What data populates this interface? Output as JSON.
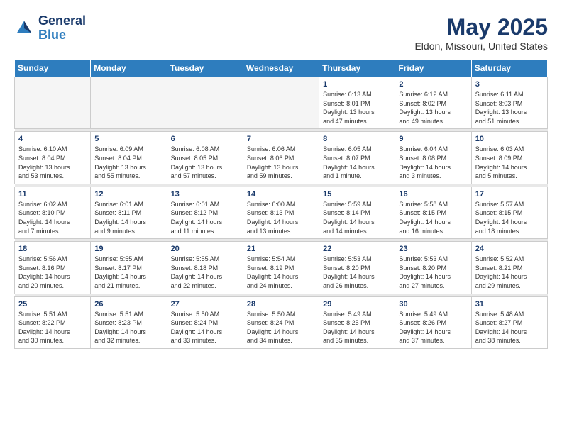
{
  "header": {
    "logo_general": "General",
    "logo_blue": "Blue",
    "title": "May 2025",
    "location": "Eldon, Missouri, United States"
  },
  "weekdays": [
    "Sunday",
    "Monday",
    "Tuesday",
    "Wednesday",
    "Thursday",
    "Friday",
    "Saturday"
  ],
  "weeks": [
    [
      {
        "day": "",
        "empty": true
      },
      {
        "day": "",
        "empty": true
      },
      {
        "day": "",
        "empty": true
      },
      {
        "day": "",
        "empty": true
      },
      {
        "day": "1",
        "info": "Sunrise: 6:13 AM\nSunset: 8:01 PM\nDaylight: 13 hours\nand 47 minutes."
      },
      {
        "day": "2",
        "info": "Sunrise: 6:12 AM\nSunset: 8:02 PM\nDaylight: 13 hours\nand 49 minutes."
      },
      {
        "day": "3",
        "info": "Sunrise: 6:11 AM\nSunset: 8:03 PM\nDaylight: 13 hours\nand 51 minutes."
      }
    ],
    [
      {
        "day": "4",
        "info": "Sunrise: 6:10 AM\nSunset: 8:04 PM\nDaylight: 13 hours\nand 53 minutes."
      },
      {
        "day": "5",
        "info": "Sunrise: 6:09 AM\nSunset: 8:04 PM\nDaylight: 13 hours\nand 55 minutes."
      },
      {
        "day": "6",
        "info": "Sunrise: 6:08 AM\nSunset: 8:05 PM\nDaylight: 13 hours\nand 57 minutes."
      },
      {
        "day": "7",
        "info": "Sunrise: 6:06 AM\nSunset: 8:06 PM\nDaylight: 13 hours\nand 59 minutes."
      },
      {
        "day": "8",
        "info": "Sunrise: 6:05 AM\nSunset: 8:07 PM\nDaylight: 14 hours\nand 1 minute."
      },
      {
        "day": "9",
        "info": "Sunrise: 6:04 AM\nSunset: 8:08 PM\nDaylight: 14 hours\nand 3 minutes."
      },
      {
        "day": "10",
        "info": "Sunrise: 6:03 AM\nSunset: 8:09 PM\nDaylight: 14 hours\nand 5 minutes."
      }
    ],
    [
      {
        "day": "11",
        "info": "Sunrise: 6:02 AM\nSunset: 8:10 PM\nDaylight: 14 hours\nand 7 minutes."
      },
      {
        "day": "12",
        "info": "Sunrise: 6:01 AM\nSunset: 8:11 PM\nDaylight: 14 hours\nand 9 minutes."
      },
      {
        "day": "13",
        "info": "Sunrise: 6:01 AM\nSunset: 8:12 PM\nDaylight: 14 hours\nand 11 minutes."
      },
      {
        "day": "14",
        "info": "Sunrise: 6:00 AM\nSunset: 8:13 PM\nDaylight: 14 hours\nand 13 minutes."
      },
      {
        "day": "15",
        "info": "Sunrise: 5:59 AM\nSunset: 8:14 PM\nDaylight: 14 hours\nand 14 minutes."
      },
      {
        "day": "16",
        "info": "Sunrise: 5:58 AM\nSunset: 8:15 PM\nDaylight: 14 hours\nand 16 minutes."
      },
      {
        "day": "17",
        "info": "Sunrise: 5:57 AM\nSunset: 8:15 PM\nDaylight: 14 hours\nand 18 minutes."
      }
    ],
    [
      {
        "day": "18",
        "info": "Sunrise: 5:56 AM\nSunset: 8:16 PM\nDaylight: 14 hours\nand 20 minutes."
      },
      {
        "day": "19",
        "info": "Sunrise: 5:55 AM\nSunset: 8:17 PM\nDaylight: 14 hours\nand 21 minutes."
      },
      {
        "day": "20",
        "info": "Sunrise: 5:55 AM\nSunset: 8:18 PM\nDaylight: 14 hours\nand 22 minutes."
      },
      {
        "day": "21",
        "info": "Sunrise: 5:54 AM\nSunset: 8:19 PM\nDaylight: 14 hours\nand 24 minutes."
      },
      {
        "day": "22",
        "info": "Sunrise: 5:53 AM\nSunset: 8:20 PM\nDaylight: 14 hours\nand 26 minutes."
      },
      {
        "day": "23",
        "info": "Sunrise: 5:53 AM\nSunset: 8:20 PM\nDaylight: 14 hours\nand 27 minutes."
      },
      {
        "day": "24",
        "info": "Sunrise: 5:52 AM\nSunset: 8:21 PM\nDaylight: 14 hours\nand 29 minutes."
      }
    ],
    [
      {
        "day": "25",
        "info": "Sunrise: 5:51 AM\nSunset: 8:22 PM\nDaylight: 14 hours\nand 30 minutes."
      },
      {
        "day": "26",
        "info": "Sunrise: 5:51 AM\nSunset: 8:23 PM\nDaylight: 14 hours\nand 32 minutes."
      },
      {
        "day": "27",
        "info": "Sunrise: 5:50 AM\nSunset: 8:24 PM\nDaylight: 14 hours\nand 33 minutes."
      },
      {
        "day": "28",
        "info": "Sunrise: 5:50 AM\nSunset: 8:24 PM\nDaylight: 14 hours\nand 34 minutes."
      },
      {
        "day": "29",
        "info": "Sunrise: 5:49 AM\nSunset: 8:25 PM\nDaylight: 14 hours\nand 35 minutes."
      },
      {
        "day": "30",
        "info": "Sunrise: 5:49 AM\nSunset: 8:26 PM\nDaylight: 14 hours\nand 37 minutes."
      },
      {
        "day": "31",
        "info": "Sunrise: 5:48 AM\nSunset: 8:27 PM\nDaylight: 14 hours\nand 38 minutes."
      }
    ]
  ]
}
